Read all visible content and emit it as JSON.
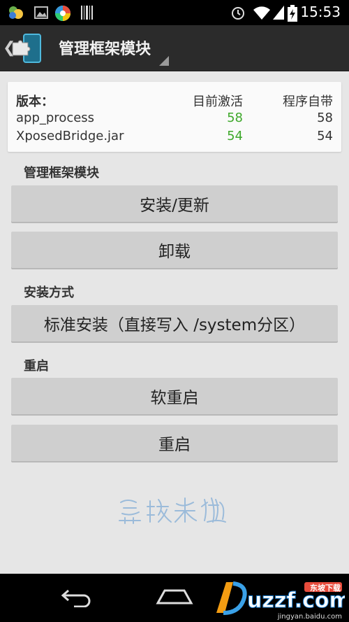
{
  "status_bar": {
    "time": "15:53",
    "left_icons": [
      "contacts-notification-icon",
      "image-notification-icon",
      "browser-app-icon",
      "barcode-icon"
    ],
    "right_icons": [
      "alarm-icon",
      "wifi-icon",
      "signal-icon",
      "battery-charging-icon"
    ]
  },
  "action_bar": {
    "title": "管理框架模块",
    "back_glyph": "❮"
  },
  "version_card": {
    "header": {
      "label": "版本：",
      "active_col": "目前激活",
      "bundled_col": "程序自带"
    },
    "rows": [
      {
        "name": "app_process",
        "active": "58",
        "bundled": "58"
      },
      {
        "name": "XposedBridge.jar",
        "active": "54",
        "bundled": "54"
      }
    ]
  },
  "sections": {
    "manage": "管理框架模块",
    "install_method": "安装方式",
    "reboot": "重启"
  },
  "buttons": {
    "install_update": "安装/更新",
    "uninstall": "卸载",
    "install_mode": "标准安装（直接写入 /system分区）",
    "soft_reboot": "软重启",
    "reboot": "重启"
  },
  "watermark": {
    "signature": "盂晓米粥"
  },
  "nav_bar": {
    "brand": "uzzf.com",
    "brand_tag": "东坡下载",
    "url": "jingyan.baidu.com"
  },
  "colors": {
    "active_version": "#3ea82b",
    "action_bar": "#2b2b2b",
    "button": "#cfcfcf",
    "background": "#e6e6e6"
  }
}
